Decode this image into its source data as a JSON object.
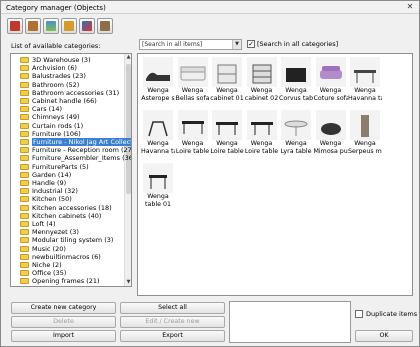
{
  "window": {
    "title": "Category manager (Objects)",
    "close": "✕"
  },
  "toolbar": {
    "buttons": [
      "home-icon",
      "furniture-icon",
      "scene-icon",
      "bag-icon",
      "catalog-icon",
      "drawer-icon"
    ]
  },
  "labels": {
    "available": "List of available categories:",
    "search_all": "[Search in all categories]"
  },
  "search": {
    "value": "[Search in all items]"
  },
  "categories": [
    "3D Warehouse (3)",
    "Archvision (6)",
    "Balustrades (23)",
    "Bathroom (52)",
    "Bathroom accessories (31)",
    "Cabinet handle (66)",
    "Cars (14)",
    "Chimneys (49)",
    "Curtain rods (1)",
    "Furniture (106)",
    "Furniture - Nikol Jag Art Collection (1",
    "Furniture - Reception room (27)",
    "Furniture_Assembler_Items (36)",
    "FurnitureParts (5)",
    "Garden (14)",
    "Handle (9)",
    "Industrial (32)",
    "Kitchen (50)",
    "Kitchen accessories (18)",
    "Kitchen cabinets (40)",
    "Loft (4)",
    "Mennyezet (3)",
    "Modular tiling system (3)",
    "Music (20)",
    "newbuiltinmacros (6)",
    "Niche (2)",
    "Office (35)",
    "Opening frames (21)"
  ],
  "items": [
    {
      "name1": "Wenga",
      "name2": "Asterope s"
    },
    {
      "name1": "Wenga",
      "name2": "Bellas sofa"
    },
    {
      "name1": "Wenga",
      "name2": "cabinet 01"
    },
    {
      "name1": "Wenga",
      "name2": "cabinet 02"
    },
    {
      "name1": "Wenga",
      "name2": "Corvus tabl"
    },
    {
      "name1": "Wenga",
      "name2": "Coture sofa"
    },
    {
      "name1": "Wenga",
      "name2": "Havanna ta"
    },
    {
      "name1": "Wenga",
      "name2": "Havanna ta"
    },
    {
      "name1": "Wenga",
      "name2": "Loire table"
    },
    {
      "name1": "Wenga",
      "name2": "Loire table"
    },
    {
      "name1": "Wenga",
      "name2": "Loire table"
    },
    {
      "name1": "Wenga",
      "name2": "Lyra table"
    },
    {
      "name1": "Wenga",
      "name2": "Mimosa pu"
    },
    {
      "name1": "Wenga",
      "name2": "Serpeus mi"
    },
    {
      "name1": "Wenga",
      "name2": "table 01"
    }
  ],
  "buttons": {
    "create": "Create new category",
    "select_all": "Select all",
    "delete": "Delete",
    "edit": "Edit / Create new",
    "import": "Import",
    "export": "Export",
    "ok": "OK",
    "duplicate": "Duplicate items"
  },
  "colors": {
    "selection": "#3a7fd0",
    "folder": "#f2cc50"
  }
}
